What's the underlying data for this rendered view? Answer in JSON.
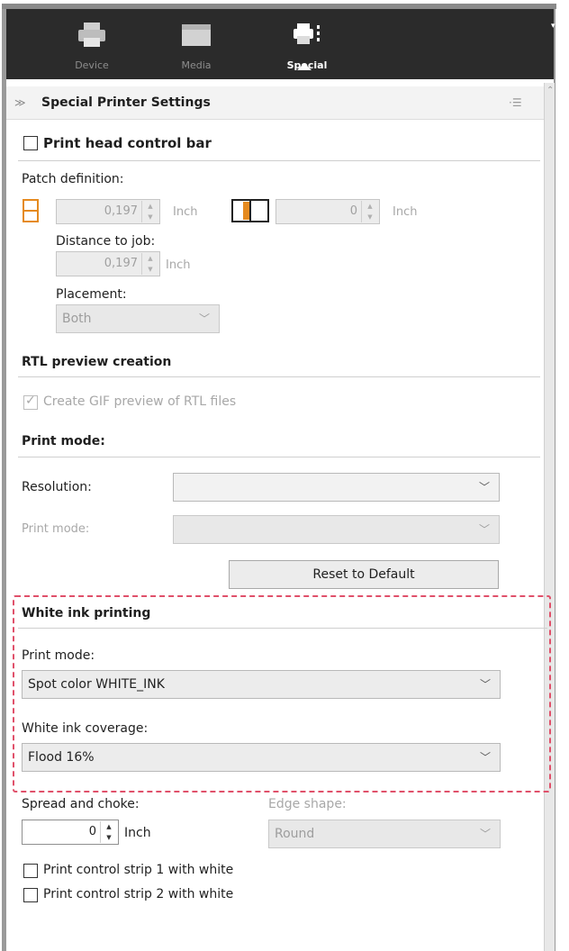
{
  "tabs": [
    {
      "label": "Device",
      "icon": "printer-icon",
      "active": false
    },
    {
      "label": "Media",
      "icon": "media-icon",
      "active": false
    },
    {
      "label": "Special",
      "icon": "special-printer-icon",
      "active": true
    }
  ],
  "panel": {
    "title": "Special Printer Settings"
  },
  "print_head": {
    "checkbox_label": "Print head control bar",
    "checked": false,
    "patch_definition_label": "Patch definition:",
    "patch_height_value": "0,197",
    "patch_height_unit": "Inch",
    "patch_width_value": "0",
    "patch_width_unit": "Inch",
    "distance_label": "Distance to job:",
    "distance_value": "0,197",
    "distance_unit": "Inch",
    "placement_label": "Placement:",
    "placement_value": "Both"
  },
  "rtl": {
    "heading": "RTL preview creation",
    "checkbox_label": "Create GIF preview of RTL files",
    "checked": true
  },
  "print_mode_section": {
    "heading": "Print mode:",
    "resolution_label": "Resolution:",
    "resolution_value": "",
    "print_mode_label": "Print mode:",
    "print_mode_value": "",
    "reset_button": "Reset to Default"
  },
  "white_ink": {
    "heading": "White ink printing",
    "print_mode_label": "Print mode:",
    "print_mode_value": "Spot color WHITE_INK",
    "coverage_label": "White ink coverage:",
    "coverage_value": "Flood  16%"
  },
  "spread": {
    "label": "Spread and choke:",
    "value": "0",
    "unit": "Inch",
    "edge_shape_label": "Edge shape:",
    "edge_shape_value": "Round"
  },
  "control_strips": [
    {
      "label": "Print control strip 1 with white",
      "checked": false
    },
    {
      "label": "Print control strip 2 with white",
      "checked": false
    }
  ],
  "colors": {
    "highlight": "#e0506a",
    "topbar": "#2b2b2b"
  }
}
